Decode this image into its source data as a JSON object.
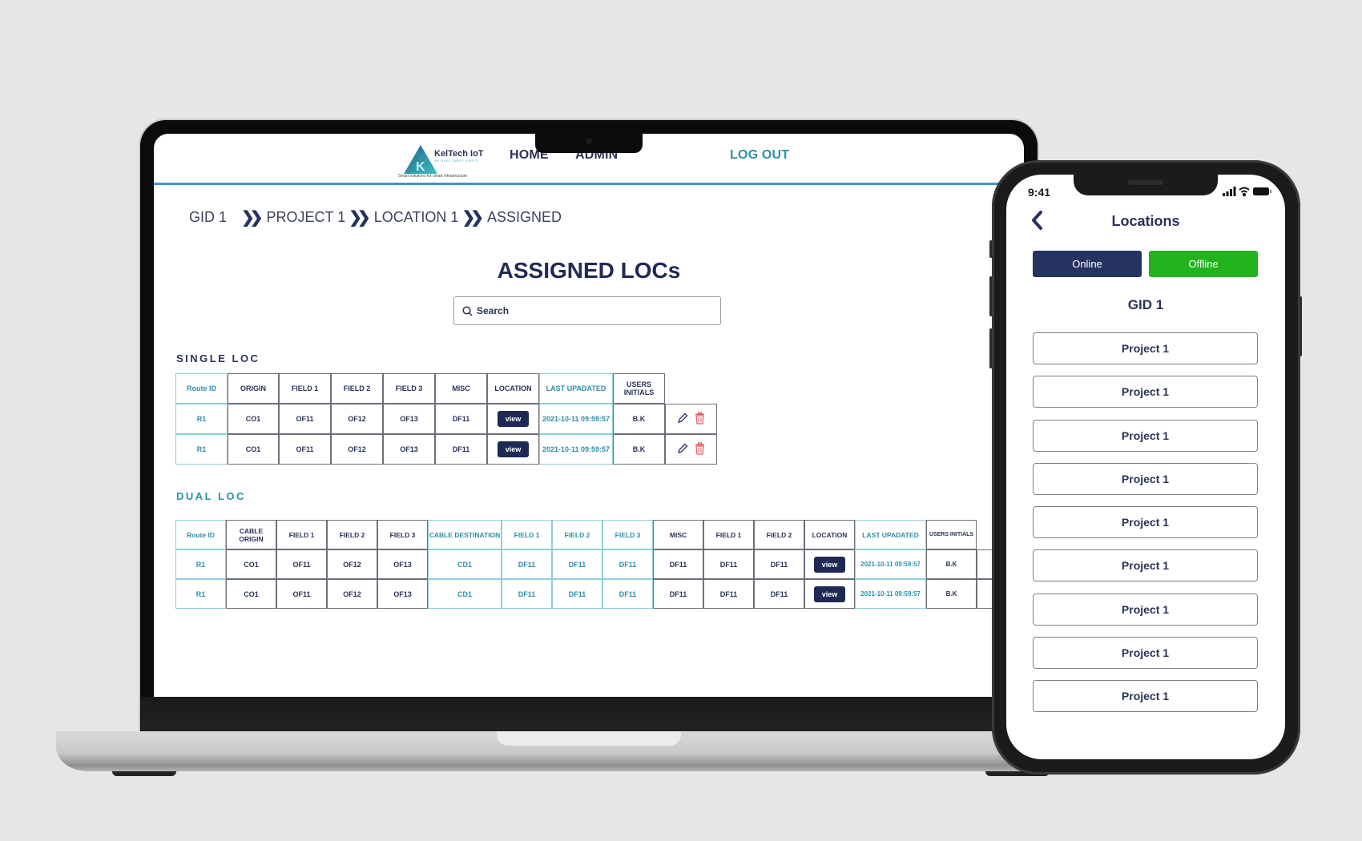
{
  "laptop": {
    "header": {
      "logo_name": "KelTech IoT",
      "logo_tagline": "WE MAKE SMART SIMPLE",
      "logo_subtitle": "Smart solutions for smart infrastructure",
      "nav": [
        "HOME",
        "ADMIN"
      ],
      "logout": "LOG OUT"
    },
    "breadcrumb": [
      "GID 1",
      "PROJECT 1",
      "LOCATION 1",
      "ASSIGNED"
    ],
    "page_title": "ASSIGNED LOCs",
    "search": {
      "placeholder": "Search"
    },
    "single_loc": {
      "title": "SINGLE LOC",
      "headers": [
        "Route ID",
        "ORIGIN",
        "FIELD 1",
        "FIELD 2",
        "FIELD 3",
        "MISC",
        "LOCATION",
        "LAST UPADATED",
        "USERS INITIALS"
      ],
      "rows": [
        [
          "R1",
          "CO1",
          "OF11",
          "OF12",
          "OF13",
          "DF11",
          "view",
          "2021-10-11 09:59:57",
          "B.K"
        ],
        [
          "R1",
          "CO1",
          "OF11",
          "OF12",
          "OF13",
          "DF11",
          "view",
          "2021-10-11 09:59:57",
          "B.K"
        ]
      ]
    },
    "dual_loc": {
      "title": "DUAL LOC",
      "headers": [
        "Route ID",
        "CABLE ORIGIN",
        "FIELD 1",
        "FIELD 2",
        "FIELD 3",
        "CABLE DESTINATION",
        "FIELD 1",
        "FIELD 2",
        "FIELD 3",
        "MISC",
        "FIELD 1",
        "FIELD 2",
        "LOCATION",
        "LAST UPADATED",
        "USERS INITIALS"
      ],
      "rows": [
        [
          "R1",
          "CO1",
          "OF11",
          "OF12",
          "OF13",
          "CD1",
          "DF11",
          "DF11",
          "DF11",
          "DF11",
          "DF11",
          "DF11",
          "view",
          "2021-10-11 09:59:57",
          "B.K"
        ],
        [
          "R1",
          "CO1",
          "OF11",
          "OF12",
          "OF13",
          "CD1",
          "DF11",
          "DF11",
          "DF11",
          "DF11",
          "DF11",
          "DF11",
          "view",
          "2021-10-11 09:59:57",
          "B.K"
        ]
      ]
    },
    "colors": {
      "navy": "#1f2955",
      "teal": "#2c8fab",
      "delete": "#e8585a"
    }
  },
  "phone": {
    "time": "9:41",
    "title": "Locations",
    "tabs": [
      {
        "label": "Online",
        "color": "#26325f"
      },
      {
        "label": "Offline",
        "color": "#22b21e"
      }
    ],
    "group": "GID 1",
    "projects": [
      "Project 1",
      "Project 1",
      "Project 1",
      "Project 1",
      "Project 1",
      "Project 1",
      "Project 1",
      "Project 1",
      "Project 1"
    ]
  }
}
